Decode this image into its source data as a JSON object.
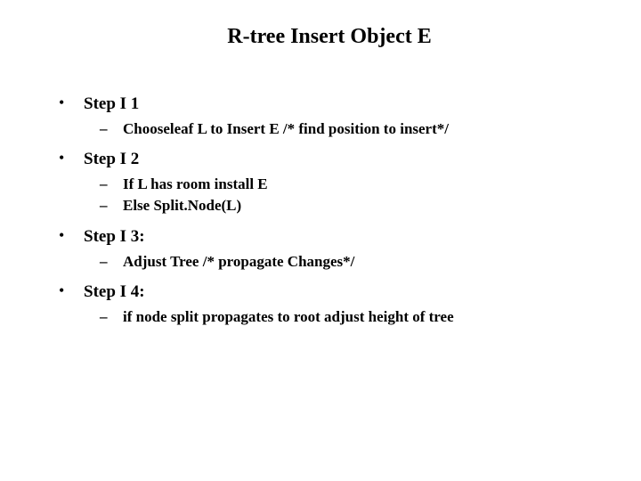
{
  "title": "R-tree Insert Object E",
  "steps": [
    {
      "label": "Step I 1",
      "subitems": [
        "Chooseleaf L to Insert E  /* find position to insert*/"
      ]
    },
    {
      "label": "Step I 2",
      "subitems": [
        "If L has room install E",
        "Else  Split.Node(L)"
      ]
    },
    {
      "label": "Step I 3:",
      "subitems": [
        "Adjust Tree /* propagate Changes*/"
      ]
    },
    {
      "label": "Step I 4:",
      "subitems": [
        "if node split propagates to root adjust height of tree"
      ]
    }
  ]
}
